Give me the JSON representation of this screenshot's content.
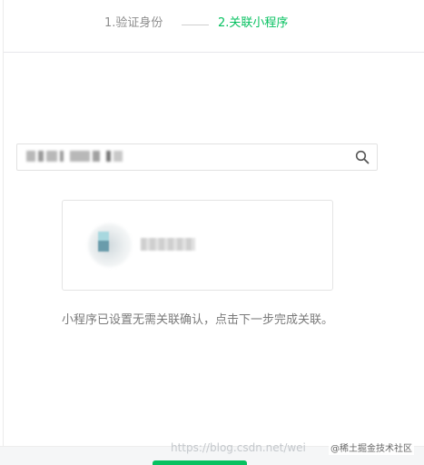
{
  "steps": {
    "step1_label": "1.验证身份",
    "step2_label": "2.关联小程序",
    "active_step_color": "#07c160"
  },
  "search": {
    "value": "",
    "icon": "search-icon"
  },
  "result_card": {
    "avatar_icon": "mini-program-avatar"
  },
  "hint": {
    "text": "小程序已设置无需关联确认，点击下一步完成关联。"
  },
  "watermark": {
    "url": "https://blog.csdn.net/wei",
    "badge": "@稀土掘金技术社区"
  },
  "colors": {
    "primary": "#07c160",
    "muted_text": "#7a7a7a"
  }
}
